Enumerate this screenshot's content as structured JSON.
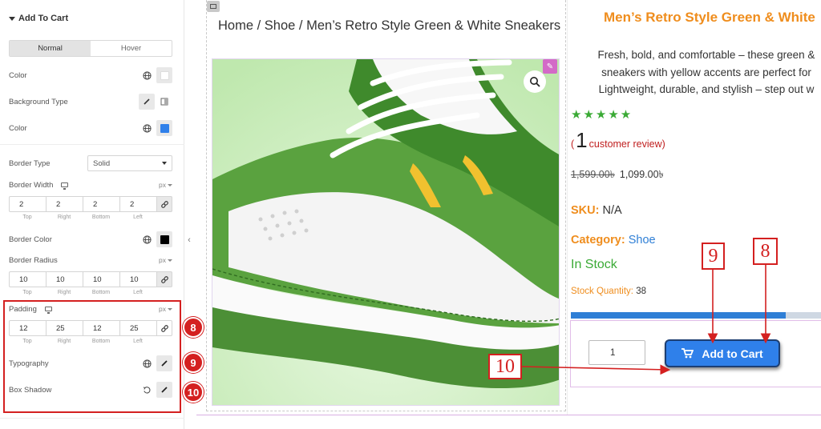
{
  "panel": {
    "section_title": "Add To Cart",
    "tabs": [
      "Normal",
      "Hover"
    ],
    "color_label": "Color",
    "bg_type_label": "Background Type",
    "color2_label": "Color",
    "border_type_label": "Border Type",
    "border_type_value": "Solid",
    "border_width_label": "Border Width",
    "border_width_unit": "px",
    "border_width_values": [
      "2",
      "2",
      "2",
      "2"
    ],
    "side_labels": [
      "Top",
      "Right",
      "Bottom",
      "Left"
    ],
    "border_color_label": "Border Color",
    "border_radius_label": "Border Radius",
    "border_radius_unit": "px",
    "border_radius_values": [
      "10",
      "10",
      "10",
      "10"
    ],
    "padding_label": "Padding",
    "padding_unit": "px",
    "padding_values": [
      "12",
      "25",
      "12",
      "25"
    ],
    "typography_label": "Typography",
    "box_shadow_label": "Box Shadow",
    "badges": [
      "8",
      "9",
      "10"
    ],
    "colors": {
      "color_swatch": "#ffffff",
      "color2_swatch": "#2f80ea",
      "border_color_swatch": "#000000"
    }
  },
  "preview": {
    "breadcrumb": {
      "home": "Home",
      "sep1": " / ",
      "category": "Shoe",
      "sep2": " / ",
      "product": "Men’s Retro Style Green & White Sneakers"
    },
    "title": "Men’s Retro Style Green & White",
    "description": [
      "Fresh, bold, and comfortable – these green &",
      "sneakers with yellow accents are perfect for",
      "Lightweight, durable, and stylish – step out w"
    ],
    "stars": "★★★★★",
    "review_open": "(",
    "review_count": "1",
    "review_text": "customer review)",
    "old_price": "1,599.00৳",
    "new_price": "1,099.00৳",
    "sku_label": "SKU:",
    "sku_value": "N/A",
    "category_label": "Category:",
    "category_value": "Shoe",
    "stock_status": "In Stock",
    "stock_qty_label": "Stock Quantity:",
    "stock_qty_value": "38",
    "stock_progress": 0.86,
    "qty_value": "1",
    "add_to_cart": "Add to Cart"
  },
  "annotations": {
    "nine": "9",
    "eight": "8",
    "ten": "10"
  },
  "accent_colors": {
    "orange": "#ef8d1d",
    "green": "#3aaa35",
    "blue": "#2f80ea",
    "red": "#d42020"
  }
}
